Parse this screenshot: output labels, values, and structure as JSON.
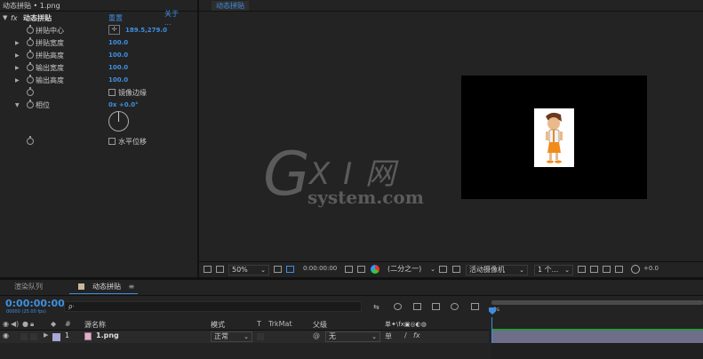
{
  "effect_panel": {
    "header": "动态拼贴 • 1.png",
    "effect_name": "动态拼贴",
    "reset_label": "重置",
    "about_label": "关于 ...",
    "fx_label": "fx",
    "props": [
      {
        "label": "拼贴中心",
        "value": "189.5,279.0"
      },
      {
        "label": "拼贴宽度",
        "value": "100.0"
      },
      {
        "label": "拼贴高度",
        "value": "100.0"
      },
      {
        "label": "输出宽度",
        "value": "100.0"
      },
      {
        "label": "输出高度",
        "value": "100.0"
      }
    ],
    "mirror_edges_label": "镜像边缘",
    "phase_label": "相位",
    "phase_value": "0x +0.0°",
    "horizontal_shift_label": "水平位移"
  },
  "comp_panel": {
    "tab_label": "动态拼贴",
    "watermark_main": "X I 网",
    "watermark_sub": "system.com",
    "toolbar": {
      "zoom": "50%",
      "timecode": "0:00:00:00",
      "resolution": "(二分之一)",
      "camera": "活动摄像机",
      "views": "1 个...",
      "exposure": "+0.0"
    }
  },
  "timeline": {
    "tab_render_queue": "渲染队列",
    "tab_comp": "动态拼贴",
    "timecode": "0:00:00:00",
    "timecode_sub": "00000 (25.00 fps)",
    "search_placeholder": "ρ·",
    "col_hash": "#",
    "col_source": "源名称",
    "col_mode": "模式",
    "col_t": "T",
    "col_trkmat": "TrkMat",
    "col_parent": "父级",
    "col_switches": "单✦\\fx▣◎◐◍",
    "ruler_zero": "0s",
    "layer": {
      "index": "1",
      "name": "1.png",
      "mode": "正常",
      "parent": "无"
    }
  },
  "colors": {
    "accent": "#3f8fe0",
    "panel_bg": "#232323",
    "green_bar": "#2a9a3a",
    "layer_label": "#a6a6d8"
  }
}
